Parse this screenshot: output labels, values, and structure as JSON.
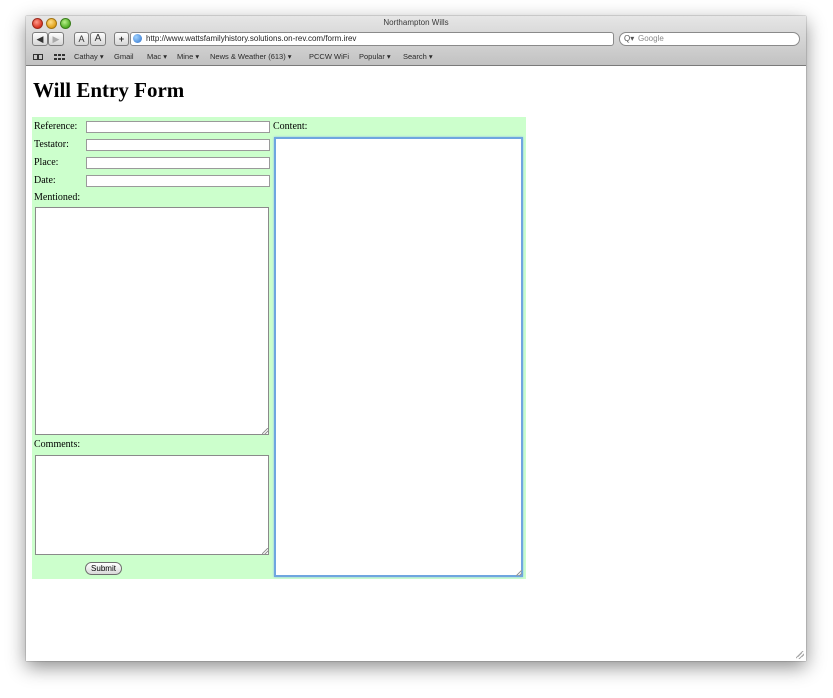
{
  "window": {
    "title": "Northampton Wills"
  },
  "toolbar": {
    "back_label": "◀",
    "forward_label": "▶",
    "text_small_label": "A",
    "text_large_label": "A",
    "add_bookmark_label": "+",
    "url": "http://www.wattsfamilyhistory.solutions.on-rev.com/form.irev",
    "reload_label": "C",
    "search_placeholder": "Google",
    "search_icon_label": "Q▾"
  },
  "bookmarks": {
    "items": [
      {
        "label": "Cathay ▾"
      },
      {
        "label": "Gmail"
      },
      {
        "label": "Mac ▾"
      },
      {
        "label": "Mine ▾"
      },
      {
        "label": "News & Weather (613) ▾"
      },
      {
        "label": "PCCW WiFi"
      },
      {
        "label": "Popular ▾"
      },
      {
        "label": "Search ▾"
      }
    ]
  },
  "page": {
    "heading": "Will Entry Form",
    "labels": {
      "reference": "Reference:",
      "testator": "Testator:",
      "place": "Place:",
      "date": "Date:",
      "mentioned": "Mentioned:",
      "comments": "Comments:",
      "content": "Content:"
    },
    "values": {
      "reference": "",
      "testator": "",
      "place": "",
      "date": "",
      "mentioned": "",
      "comments": "",
      "content": ""
    },
    "submit_label": "Submit"
  },
  "colors": {
    "form_background": "#ccffcc",
    "focus_ring": "#6fa6e0"
  }
}
